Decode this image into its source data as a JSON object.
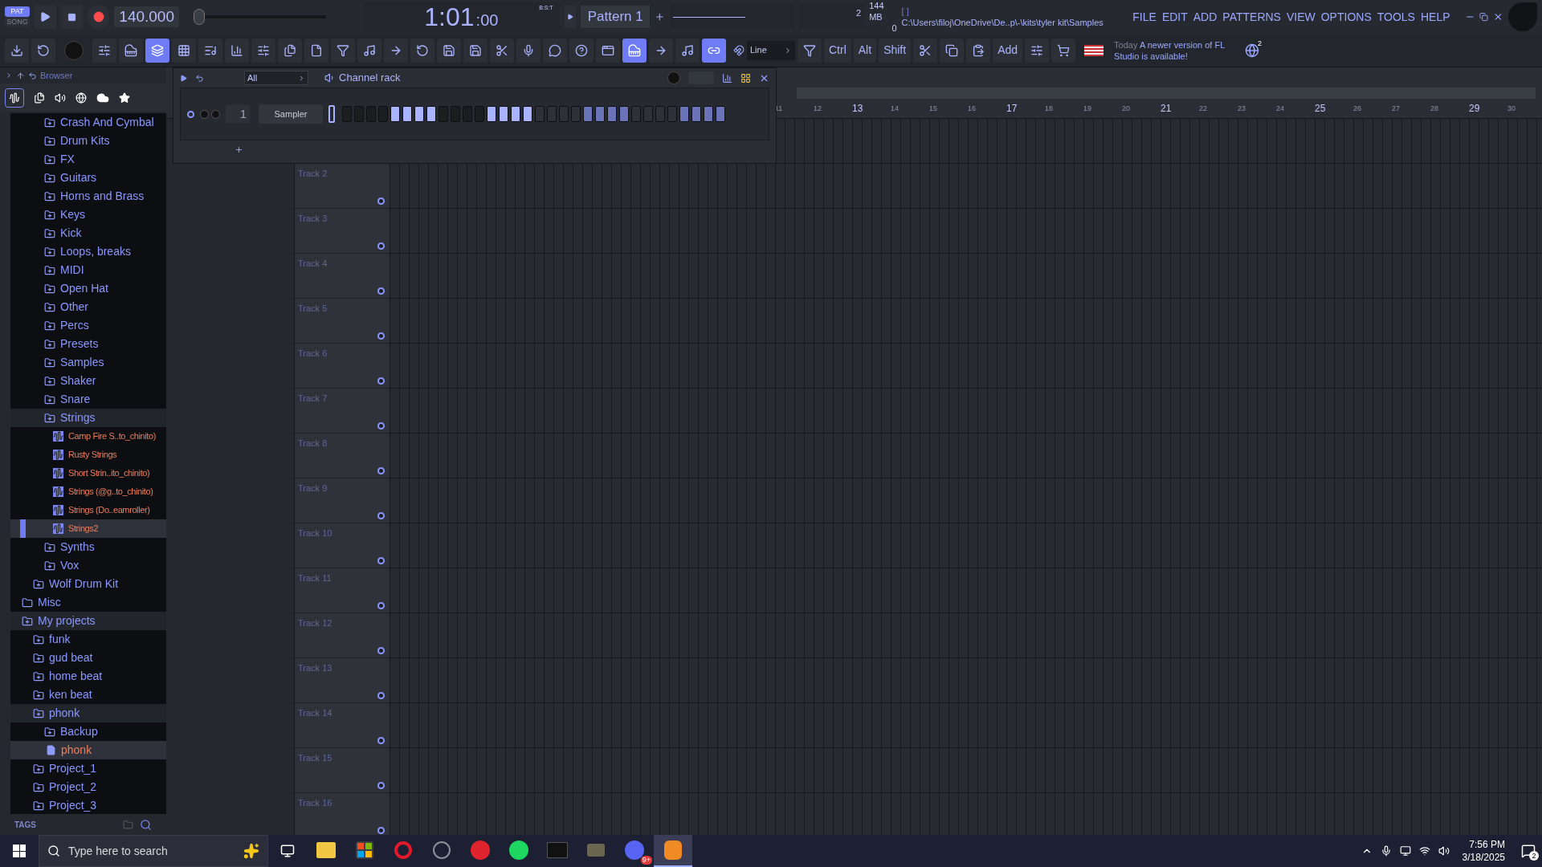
{
  "transport": {
    "modes": [
      {
        "label": "PAT",
        "selected": true
      },
      {
        "label": "SONG",
        "selected": false
      }
    ],
    "tempo": "140.000",
    "pitch": {
      "level": 0.03
    },
    "time": "1:01",
    "time_ticks": ":00",
    "time_format": "B:S:T",
    "pattern": "Pattern 1",
    "memory": "144 MB",
    "cpu": "0",
    "hint_brackets": "[  ]",
    "path": "C:\\Users\\filoj\\OneDrive\\De..p\\-\\kits\\tyler kit\\Samples",
    "step_counter": "2"
  },
  "menu": [
    "FILE",
    "EDIT",
    "ADD",
    "PATTERNS",
    "VIEW",
    "OPTIONS",
    "TOOLS",
    "HELP"
  ],
  "toolbar": {
    "snap": "Line",
    "keys": [
      "Ctrl",
      "Alt",
      "Shift"
    ],
    "add": "Add",
    "news_day": "Today",
    "news": "A newer version of FL Studio is available!",
    "news_count": "2"
  },
  "browser": {
    "title": "Browser",
    "tags": "TAGS",
    "tree": [
      {
        "kind": "offscreen",
        "children": [
          {
            "kind": "offscreen",
            "children": [
              {
                "kind": "folder",
                "label": "Crash And Cymbal"
              },
              {
                "kind": "folder",
                "label": "Drum Kits"
              },
              {
                "kind": "folder",
                "label": "FX"
              },
              {
                "kind": "folder",
                "label": "Guitars"
              },
              {
                "kind": "folder",
                "label": "Horns and Brass"
              },
              {
                "kind": "folder",
                "label": "Keys"
              },
              {
                "kind": "folder",
                "label": "Kick"
              },
              {
                "kind": "folder",
                "label": "Loops, breaks"
              },
              {
                "kind": "folder",
                "label": "MIDI"
              },
              {
                "kind": "folder",
                "label": "Open Hat"
              },
              {
                "kind": "folder",
                "label": "Other"
              },
              {
                "kind": "folder",
                "label": "Percs"
              },
              {
                "kind": "folder",
                "label": "Presets"
              },
              {
                "kind": "folder",
                "label": "Samples"
              },
              {
                "kind": "folder",
                "label": "Shaker"
              },
              {
                "kind": "folder",
                "label": "Snare"
              },
              {
                "kind": "folder",
                "label": "Strings",
                "expanded": true,
                "children": [
                  {
                    "kind": "sample",
                    "label": "Camp Fire S..to_chinito)",
                    "selected": false
                  },
                  {
                    "kind": "sample",
                    "label": "Rusty Strings",
                    "selected": false
                  },
                  {
                    "kind": "sample",
                    "label": "Short Strin..ito_chinito)",
                    "selected": false
                  },
                  {
                    "kind": "sample",
                    "label": "Strings (@g..to_chinito)",
                    "selected": false
                  },
                  {
                    "kind": "sample",
                    "label": "Strings (Do..eamroller)",
                    "selected": false
                  },
                  {
                    "kind": "sample",
                    "label": "Strings2",
                    "selected": true
                  }
                ]
              },
              {
                "kind": "folder",
                "label": "Synths"
              },
              {
                "kind": "folder",
                "label": "Vox"
              }
            ]
          },
          {
            "kind": "folder",
            "label": "Wolf Drum Kit"
          }
        ]
      },
      {
        "kind": "plain-folder",
        "label": "Misc"
      },
      {
        "kind": "folder",
        "label": "My projects",
        "expanded": true,
        "children": [
          {
            "kind": "folder",
            "label": "funk"
          },
          {
            "kind": "folder",
            "label": "gud beat"
          },
          {
            "kind": "folder",
            "label": "home beat"
          },
          {
            "kind": "folder",
            "label": "ken beat"
          },
          {
            "kind": "folder",
            "label": "phonk",
            "expanded": true,
            "children": [
              {
                "kind": "folder",
                "label": "Backup"
              },
              {
                "kind": "project",
                "label": "phonk",
                "selected": true
              }
            ]
          },
          {
            "kind": "folder",
            "label": "Project_1"
          },
          {
            "kind": "folder",
            "label": "Project_2"
          },
          {
            "kind": "folder",
            "label": "Project_3"
          }
        ]
      }
    ]
  },
  "channel_rack": {
    "filter": "All",
    "title": "Channel rack",
    "channel_number": "1",
    "channel_name": "Sampler",
    "steps": [
      {
        "on": false
      },
      {
        "on": false
      },
      {
        "on": false
      },
      {
        "on": false
      },
      {
        "on": true
      },
      {
        "on": true
      },
      {
        "on": true
      },
      {
        "on": true
      },
      {
        "on": false
      },
      {
        "on": false
      },
      {
        "on": false
      },
      {
        "on": false
      },
      {
        "on": true
      },
      {
        "on": true
      },
      {
        "on": true
      },
      {
        "on": true
      },
      {
        "on": false
      },
      {
        "on": false
      },
      {
        "on": false
      },
      {
        "on": false
      },
      {
        "on": true
      },
      {
        "on": true
      },
      {
        "on": true
      },
      {
        "on": true
      },
      {
        "on": false
      },
      {
        "on": false
      },
      {
        "on": false
      },
      {
        "on": false
      },
      {
        "on": true
      },
      {
        "on": true
      },
      {
        "on": true
      },
      {
        "on": true
      }
    ]
  },
  "playlist": {
    "bars": [
      {
        "label": "11",
        "kind": "minor"
      },
      {
        "label": "12",
        "kind": "minor"
      },
      {
        "label": "13",
        "kind": "major"
      },
      {
        "label": "14",
        "kind": "minor"
      },
      {
        "label": "15",
        "kind": "minor"
      },
      {
        "label": "16",
        "kind": "minor"
      },
      {
        "label": "17",
        "kind": "major"
      },
      {
        "label": "18",
        "kind": "minor"
      },
      {
        "label": "19",
        "kind": "minor"
      },
      {
        "label": "20",
        "kind": "minor"
      },
      {
        "label": "21",
        "kind": "major"
      },
      {
        "label": "22",
        "kind": "minor"
      },
      {
        "label": "23",
        "kind": "minor"
      },
      {
        "label": "24",
        "kind": "minor"
      },
      {
        "label": "25",
        "kind": "major"
      },
      {
        "label": "26",
        "kind": "minor"
      },
      {
        "label": "27",
        "kind": "minor"
      },
      {
        "label": "28",
        "kind": "minor"
      },
      {
        "label": "29",
        "kind": "major"
      },
      {
        "label": "30",
        "kind": "minor"
      }
    ],
    "tracks": [
      "Track 2",
      "Track 3",
      "Track 4",
      "Track 5",
      "Track 6",
      "Track 7",
      "Track 8",
      "Track 9",
      "Track 10",
      "Track 11",
      "Track 12",
      "Track 13",
      "Track 14",
      "Track 15",
      "Track 16"
    ]
  },
  "taskbar": {
    "search_placeholder": "Type here to search",
    "apps": [
      {
        "kind": "files",
        "active": false
      },
      {
        "kind": "store",
        "active": false
      },
      {
        "kind": "opera",
        "active": false
      },
      {
        "kind": "atom",
        "active": false
      },
      {
        "kind": "video",
        "active": false
      },
      {
        "kind": "music",
        "active": false
      },
      {
        "kind": "game",
        "active": false
      },
      {
        "kind": "box",
        "active": false
      },
      {
        "kind": "chat",
        "active": false,
        "badge": "9+"
      },
      {
        "kind": "daw",
        "active": true
      }
    ],
    "time": "7:56 PM",
    "date": "3/18/2025",
    "notifications": "2"
  }
}
